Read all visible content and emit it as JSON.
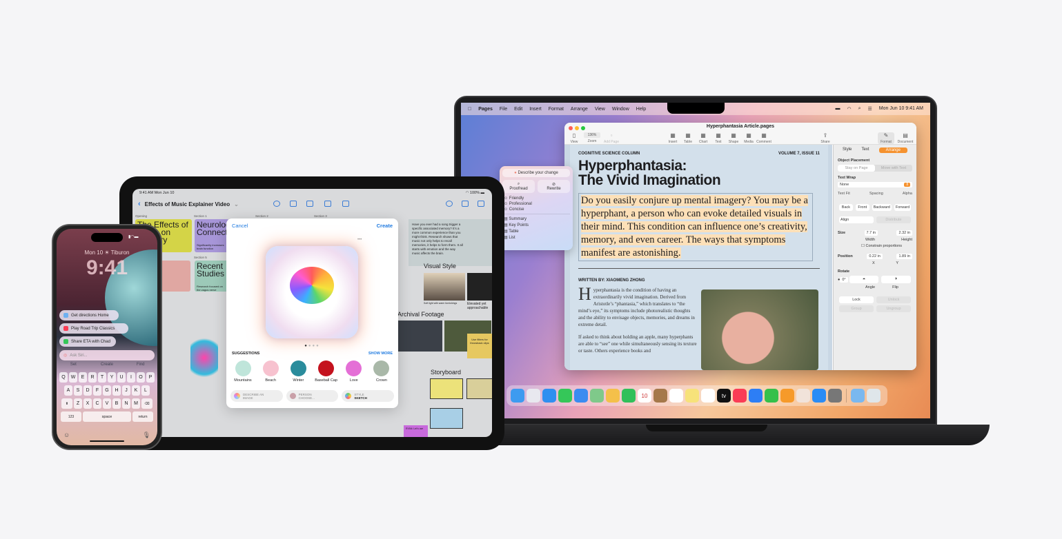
{
  "mac": {
    "menubar": {
      "apple_icon": "apple-logo",
      "app": "Pages",
      "menus": [
        "File",
        "Edit",
        "Insert",
        "Format",
        "Arrange",
        "View",
        "Window",
        "Help"
      ],
      "status_icons": [
        "battery-icon",
        "wifi-icon",
        "search-icon",
        "control-center-icon"
      ],
      "clock": "Mon Jun 10  9:41 AM"
    },
    "window": {
      "title": "Hyperphantasia Article.pages",
      "zoom": "136%",
      "toolbar_left": [
        {
          "label": "View",
          "icon": "sidebar-icon"
        },
        {
          "label": "Zoom",
          "icon": "zoom"
        },
        {
          "label": "Add Page",
          "icon": "add-page-icon"
        }
      ],
      "toolbar_mid": [
        {
          "label": "Insert",
          "icon": "insert-icon"
        },
        {
          "label": "Table",
          "icon": "table-icon"
        },
        {
          "label": "Chart",
          "icon": "chart-icon"
        },
        {
          "label": "Text",
          "icon": "text-icon"
        },
        {
          "label": "Shape",
          "icon": "shape-icon"
        },
        {
          "label": "Media",
          "icon": "media-icon"
        },
        {
          "label": "Comment",
          "icon": "comment-icon"
        }
      ],
      "share": "Share",
      "format": "Format",
      "document": "Document"
    },
    "doc": {
      "column": "COGNITIVE SCIENCE COLUMN",
      "issue": "VOLUME 7, ISSUE 11",
      "headline_1": "Hyperphantasia:",
      "headline_2": "The Vivid Imagination",
      "lede": "Do you easily conjure up mental imagery? You may be a hyperphant, a person who can evoke detailed visuals in their mind. This condition can influence one’s creativity, memory, and even career. The ways that symptoms manifest are astonishing.",
      "byline": "WRITTEN BY: XIAOMENG ZHONG",
      "drop_cap": "H",
      "p1": "yperphantasia is the condition of having an extraordinarily vivid imagination. Derived from Aristotle’s “phantasia,” which translates to “the mind’s eye,” its symptoms include photorealistic thoughts and the ability to envisage objects, memories, and dreams in extreme detail.",
      "p2": "If asked to think about holding an apple, many hyperphants are able to “see” one while simultaneously sensing its texture or taste. Others experience books and"
    },
    "writing_tools": {
      "describe": "Describe your change",
      "proofread": "Proofread",
      "rewrite": "Rewrite",
      "tones": [
        "Friendly",
        "Professional",
        "Concise"
      ],
      "formats": [
        "Summary",
        "Key Points",
        "Table",
        "List"
      ]
    },
    "inspector": {
      "tabs": [
        "Style",
        "Text",
        "Arrange"
      ],
      "active_tab": "Arrange",
      "object_placement": "Object Placement",
      "placement_options": [
        "Stay on Page",
        "Move with Text"
      ],
      "text_wrap": "Text Wrap",
      "wrap_value": "None",
      "text_fit": "Text Fit",
      "spacing": "Spacing",
      "alpha": "Alpha",
      "order": [
        "Back",
        "Front",
        "Backward",
        "Forward"
      ],
      "align": "Align",
      "distribute": "Distribute",
      "size": "Size",
      "width": "7.7 in",
      "height": "2.32 in",
      "width_label": "Width",
      "height_label": "Height",
      "constrain": "Constrain proportions",
      "position": "Position",
      "x": "0.22 in",
      "y": "1.89 in",
      "x_label": "X",
      "y_label": "Y",
      "rotate": "Rotate",
      "angle": "0°",
      "angle_label": "Angle",
      "flip": "Flip",
      "lock": "Lock",
      "unlock": "Unlock",
      "group": "Group",
      "ungroup": "Ungroup",
      "accent": "#f5922f"
    },
    "dock": [
      {
        "name": "finder",
        "color": "#3d9bf0"
      },
      {
        "name": "launchpad",
        "color": "#e8e8ef"
      },
      {
        "name": "safari",
        "color": "#2f8ff0"
      },
      {
        "name": "messages",
        "color": "#35c759"
      },
      {
        "name": "mail",
        "color": "#3a8cf0"
      },
      {
        "name": "maps",
        "color": "#7fc98a"
      },
      {
        "name": "photos",
        "color": "#f4c04a"
      },
      {
        "name": "facetime",
        "color": "#30c05a"
      },
      {
        "name": "calendar",
        "color": "#ffffff",
        "text": "10"
      },
      {
        "name": "contacts",
        "color": "#a5784a"
      },
      {
        "name": "reminders",
        "color": "#ffffff"
      },
      {
        "name": "notes",
        "color": "#f7e27a"
      },
      {
        "name": "freeform",
        "color": "#ffffff"
      },
      {
        "name": "tv",
        "color": "#111111",
        "text": "tv"
      },
      {
        "name": "music",
        "color": "#fa3c55"
      },
      {
        "name": "keynote",
        "color": "#2d7ef5"
      },
      {
        "name": "numbers",
        "color": "#35c04a"
      },
      {
        "name": "pages",
        "color": "#f69a2a"
      },
      {
        "name": "iphone-mirroring",
        "color": "#f1e3da"
      },
      {
        "name": "app-store",
        "color": "#2a8cf5"
      },
      {
        "name": "system-settings",
        "color": "#777777"
      },
      {
        "name": "downloads",
        "color": "#7ab8ef"
      },
      {
        "name": "trash",
        "color": "#dfe6ea"
      }
    ]
  },
  "ipad": {
    "time": "9:41 AM  Mon Jun 10",
    "battery": "100%",
    "title": "Effects of Music Explainer Video",
    "sections": [
      "Opening",
      "Section 1",
      "Section 2",
      "Section 3",
      "Section 5"
    ],
    "cards": {
      "opening": "The Effects of Music on Memory",
      "s1": "Neurological Connections",
      "s1_sub": "Significantly increases brain function",
      "s5": "Recent Studies",
      "s5_sub": "Research focused on the vagus nerve"
    },
    "note": "Have you ever had a song trigger a specific associated memory? It’s a more common experience than you might think. Research shows that music not only helps to recall memories, it helps to form them. It all starts with emotion and the way music affects the brain.",
    "visual_style": "Visual Style",
    "visual_caption": "Soft light with warm furnishings",
    "visual_caption_2": "Elevated yet approachable",
    "archival": "Archival Footage",
    "sticky": "Use filters for throwback clips",
    "storyboard": "Storyboard",
    "sticky2": "RYAN: Let's use",
    "modal": {
      "cancel": "Cancel",
      "create": "Create",
      "suggestions": "SUGGESTIONS",
      "show_more": "SHOW MORE",
      "items": [
        {
          "label": "Mountains",
          "color": "#bfe5da"
        },
        {
          "label": "Beach",
          "color": "#f7c2cf"
        },
        {
          "label": "Winter",
          "color": "#2a8c9c"
        },
        {
          "label": "Baseball Cap",
          "color": "#c4121e"
        },
        {
          "label": "Love",
          "color": "#e46fd6"
        },
        {
          "label": "Crown",
          "color": "#a9b8a8"
        }
      ],
      "chips": [
        {
          "line1": "DESCRIBE AN",
          "line2": "IMAGE"
        },
        {
          "line1": "PERSON",
          "line2": "CHOOSE..."
        },
        {
          "line1": "STYLE",
          "line2": "SKETCH"
        }
      ]
    }
  },
  "iphone": {
    "date": "Mon 10  ☀ Tiburon",
    "time": "9:41",
    "suggestions": [
      {
        "label": "Get directions Home",
        "color": "#6fb0f0"
      },
      {
        "label": "Play Road Trip Classics",
        "color": "#fa3c55"
      },
      {
        "label": "Share ETA with Chad",
        "color": "#35c759"
      }
    ],
    "ask": "Ask Siri...",
    "predictions": [
      "Set",
      "Create",
      "Find"
    ],
    "rows": [
      [
        "Q",
        "W",
        "E",
        "R",
        "T",
        "Y",
        "U",
        "I",
        "O",
        "P"
      ],
      [
        "A",
        "S",
        "D",
        "F",
        "G",
        "H",
        "J",
        "K",
        "L"
      ],
      [
        "Z",
        "X",
        "C",
        "V",
        "B",
        "N",
        "M"
      ]
    ],
    "num": "123",
    "space": "space",
    "return": "return"
  }
}
